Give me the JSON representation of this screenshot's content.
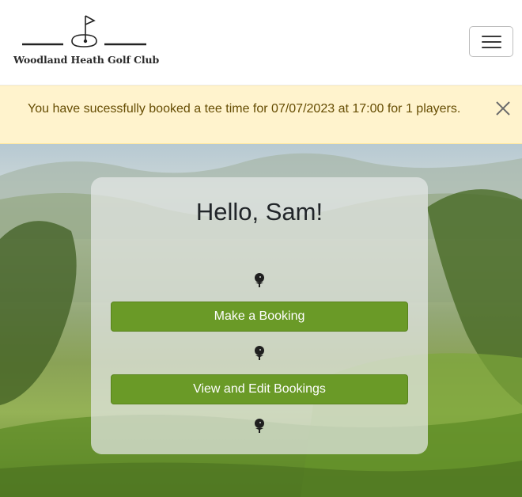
{
  "brand": {
    "name": "Woodland Heath Golf Club",
    "logo_icon": "golf-flag-icon"
  },
  "navbar": {
    "toggle_icon": "hamburger-menu-icon"
  },
  "alert": {
    "message": "You have sucessfully booked a tee time for 07/07/2023 at 17:00 for 1 players.",
    "close_icon": "close-icon",
    "background": "#fff3cd",
    "text_color": "#664d03"
  },
  "main": {
    "greeting": "Hello, Sam!",
    "divider_icon": "golf-ball-on-tee-icon",
    "buttons": {
      "make_booking": "Make a Booking",
      "view_edit_bookings": "View and Edit Bookings"
    },
    "button_color": "#6a9a27"
  }
}
